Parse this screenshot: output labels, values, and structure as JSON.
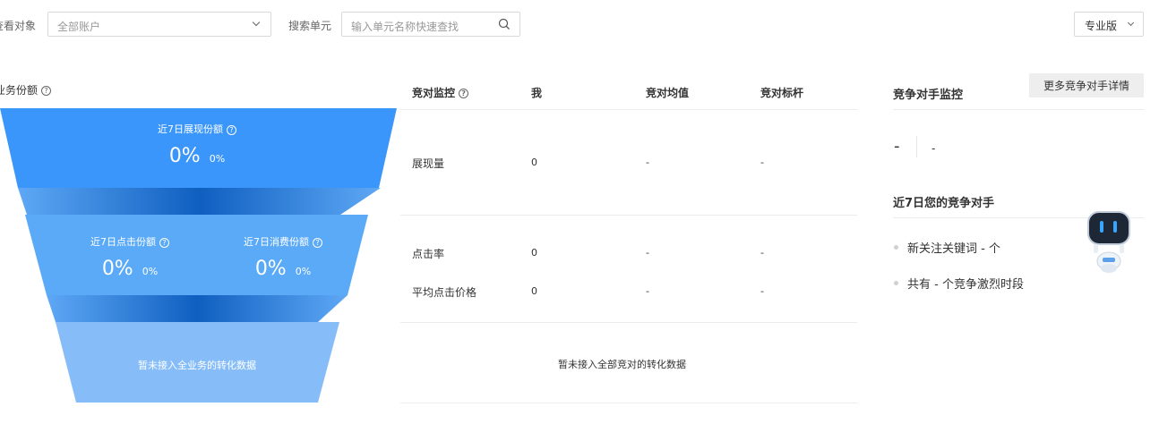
{
  "filters": {
    "target_label": "查看对象",
    "target_value": "全部账户",
    "search_label": "搜索单元",
    "search_placeholder": "输入单元名称快速查找",
    "version_label": "专业版"
  },
  "funnel": {
    "title": "业务份额",
    "impression": {
      "label": "近7日展现份额",
      "big": "0%",
      "small": "0%"
    },
    "click": {
      "label": "近7日点击份额",
      "big": "0%",
      "small": "0%"
    },
    "spend": {
      "label": "近7日消费份额",
      "big": "0%",
      "small": "0%"
    },
    "conversion": "暂未接入全业务的转化数据"
  },
  "monitor": {
    "headers": {
      "metric": "竞对监控",
      "me": "我",
      "avg": "竞对均值",
      "bench": "竞对标杆"
    },
    "rows": [
      {
        "metric": "展现量",
        "me": "0",
        "avg": "-",
        "bench": "-"
      },
      {
        "metric": "点击率",
        "me": "0",
        "avg": "-",
        "bench": "-"
      },
      {
        "metric": "平均点击价格",
        "me": "0",
        "avg": "-",
        "bench": "-"
      }
    ],
    "conversion": "暂未接入全部竞对的转化数据"
  },
  "competitor": {
    "title": "竞争对手监控",
    "more_button": "更多竞争对手详情",
    "value_big": "-",
    "value_small": "-",
    "recent_title": "近7日您的竞争对手",
    "items": [
      "新关注关键词 - 个",
      "共有 - 个竞争激烈时段"
    ]
  },
  "colors": {
    "funnel_top": "#3a96fa",
    "funnel_mid": "#5aaaf7",
    "funnel_bottom": "#86bdf9",
    "connector": "#1f6fd1"
  }
}
